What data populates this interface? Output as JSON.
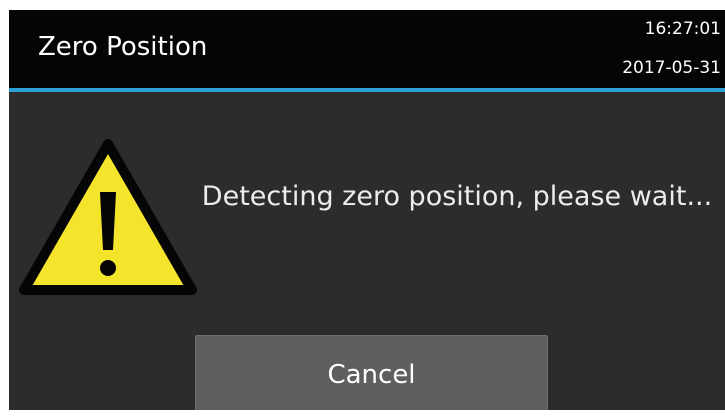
{
  "header": {
    "title": "Zero Position",
    "time": "16:27:01",
    "date": "2017-05-31"
  },
  "dialog": {
    "message": "Detecting zero position, please wait...",
    "icon": "warning-triangle-icon",
    "cancel_label": "Cancel"
  },
  "colors": {
    "background": "#2c2c2c",
    "header": "#050505",
    "accent": "#2aa3d4",
    "warning_fill": "#f5e42c",
    "button": "#5f5f5f"
  }
}
